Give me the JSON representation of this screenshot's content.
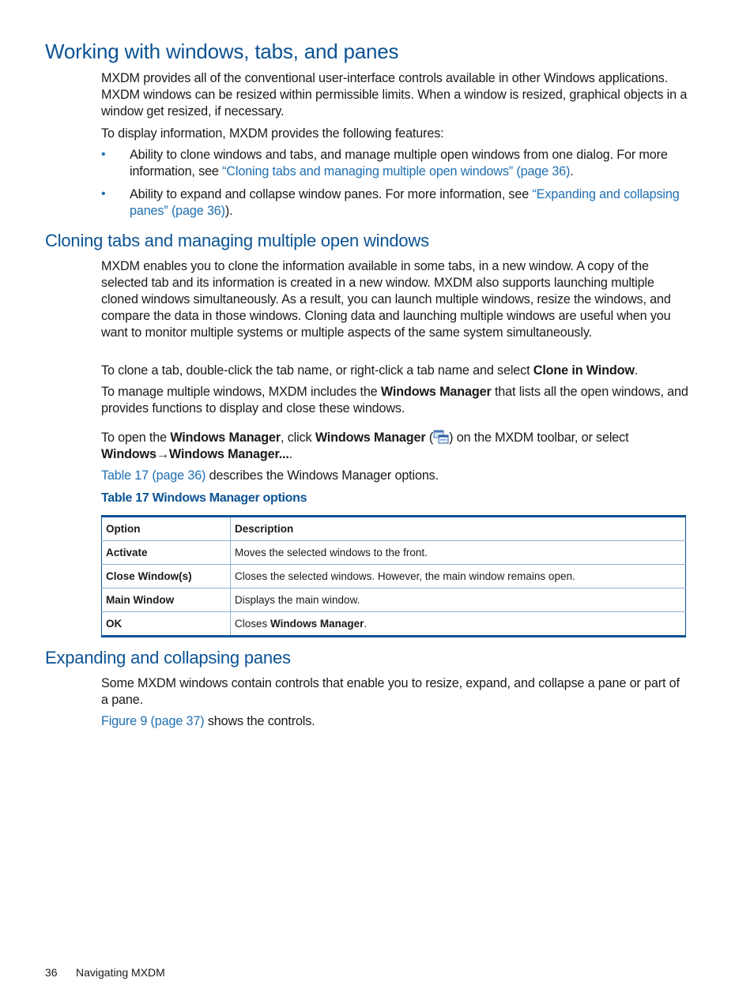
{
  "section1": {
    "title": "Working with windows, tabs, and panes",
    "intro": "MXDM provides all of the conventional user-interface controls available in other Windows applications. MXDM windows can be resized within permissible limits. When a window is resized, graphical objects in a window get resized, if necessary.",
    "features_lead": "To display information, MXDM provides the following features:",
    "bullets": [
      {
        "text": "Ability to clone windows and tabs, and manage multiple open windows from one dialog. For more information, see ",
        "link": "“Cloning tabs and managing multiple open windows” (page 36)",
        "tail": "."
      },
      {
        "text": "Ability to expand and collapse window panes. For more information, see ",
        "link": "“Expanding and collapsing panes” (page 36)",
        "tail": ")."
      }
    ]
  },
  "section2": {
    "title": "Cloning tabs and managing multiple open windows",
    "para1": "MXDM enables you to clone the information available in some tabs, in a new window. A copy of the selected tab and its information is created in a new window. MXDM also supports launching multiple cloned windows simultaneously. As a result, you can launch multiple windows, resize the windows, and compare the data in those windows. Cloning data and launching multiple windows are useful when you want to monitor multiple systems or multiple aspects of the same system simultaneously.",
    "para2_pre": "To clone a tab, double-click the tab name, or right-click a tab name and select ",
    "para2_bold": "Clone in Window",
    "para2_post": ".",
    "para3_pre": "To manage multiple windows, MXDM includes the ",
    "para3_bold": "Windows Manager",
    "para3_post": " that lists all the open windows, and provides functions to display and close these windows.",
    "para4_a": "To open the ",
    "para4_b": "Windows Manager",
    "para4_c": ", click ",
    "para4_d": "Windows Manager",
    "para4_e": " (",
    "para4_icon": "windows-manager-icon",
    "para4_f": ") on the MXDM toolbar, or select ",
    "para4_g": "Windows",
    "para4_arrow": "→",
    "para4_h": "Windows Manager...",
    "para4_i": ".",
    "para5_link": "Table 17 (page 36)",
    "para5_post": " describes the Windows Manager options.",
    "table_caption": "Table 17 Windows Manager options",
    "table": {
      "headers": [
        "Option",
        "Description"
      ],
      "rows": [
        {
          "option": "Activate",
          "desc": "Moves the selected windows to the front.",
          "desc_bold": ""
        },
        {
          "option": "Close Window(s)",
          "desc": "Closes the selected windows. However, the main window remains open.",
          "desc_bold": ""
        },
        {
          "option": "Main Window",
          "desc": "Displays the main window.",
          "desc_bold": ""
        },
        {
          "option": "OK",
          "desc": "Closes ",
          "desc_bold": "Windows Manager",
          "desc_tail": "."
        }
      ]
    }
  },
  "section3": {
    "title": "Expanding and collapsing panes",
    "para1": "Some MXDM windows contain controls that enable you to resize, expand, and collapse a pane or part of a pane.",
    "para2_link": "Figure 9 (page 37)",
    "para2_post": " shows the controls."
  },
  "footer": {
    "page_number": "36",
    "chapter": "Navigating MXDM"
  },
  "colors": {
    "heading": "#0b5394",
    "link": "#1f6fb2",
    "table_rule": "#0b5394",
    "table_grid": "#8fb0cf"
  }
}
